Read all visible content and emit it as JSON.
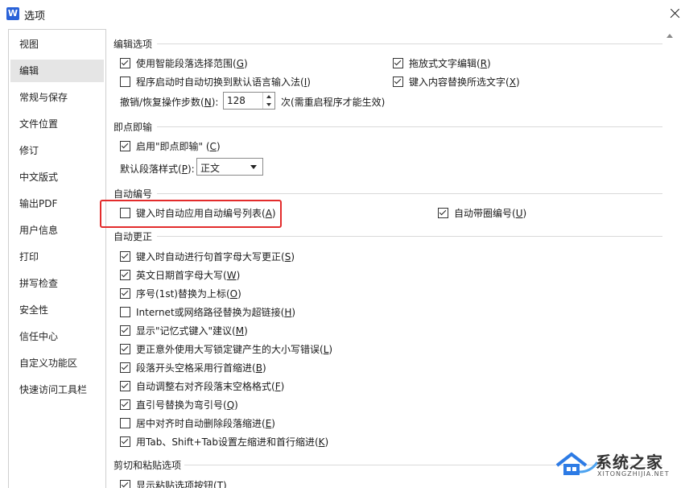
{
  "window": {
    "title": "选项",
    "app_icon_letter": "W"
  },
  "sidebar": {
    "items": [
      {
        "label": "视图",
        "selected": false
      },
      {
        "label": "编辑",
        "selected": true
      },
      {
        "label": "常规与保存",
        "selected": false
      },
      {
        "label": "文件位置",
        "selected": false
      },
      {
        "label": "修订",
        "selected": false
      },
      {
        "label": "中文版式",
        "selected": false
      },
      {
        "label": "输出PDF",
        "selected": false
      },
      {
        "label": "用户信息",
        "selected": false
      },
      {
        "label": "打印",
        "selected": false
      },
      {
        "label": "拼写检查",
        "selected": false
      },
      {
        "label": "安全性",
        "selected": false
      },
      {
        "label": "信任中心",
        "selected": false
      },
      {
        "label": "自定义功能区",
        "selected": false
      },
      {
        "label": "快速访问工具栏",
        "selected": false
      }
    ]
  },
  "edit_options": {
    "heading": "编辑选项",
    "smart_select": {
      "label": "使用智能段落选择范围",
      "key": "G",
      "checked": true
    },
    "auto_ime": {
      "label": "程序启动时自动切换到默认语言输入法",
      "key": "I",
      "checked": false
    },
    "drag_drop": {
      "label": "拖放式文字编辑",
      "key": "R",
      "checked": true
    },
    "typing_replaces": {
      "label": "键入内容替换所选文字",
      "key": "X",
      "checked": true
    },
    "undo_steps": {
      "label": "撤销/恢复操作步数",
      "key": "N",
      "value": "128",
      "note": "次(需重启程序才能生效)"
    }
  },
  "click_and_type": {
    "heading": "即点即输",
    "enable": {
      "label": "启用\"即点即输\"",
      "key": "C",
      "checked": true
    },
    "default_style": {
      "label": "默认段落样式",
      "key": "P",
      "value": "正文"
    }
  },
  "auto_numbering": {
    "heading": "自动编号",
    "auto_list": {
      "label": "键入时自动应用自动编号列表",
      "key": "A",
      "checked": false
    },
    "circled": {
      "label": "自动带圈编号",
      "key": "U",
      "checked": true
    },
    "highlight_color": "#e32c2c"
  },
  "auto_correct": {
    "heading": "自动更正",
    "items": [
      {
        "label": "键入时自动进行句首字母大写更正",
        "key": "S",
        "checked": true
      },
      {
        "label": "英文日期首字母大写",
        "key": "W",
        "checked": true
      },
      {
        "label": "序号(1st)替换为上标",
        "key": "O",
        "checked": true
      },
      {
        "label": "Internet或网络路径替换为超链接",
        "key": "H",
        "checked": false
      },
      {
        "label": "显示\"记忆式键入\"建议",
        "key": "M",
        "checked": true
      },
      {
        "label": "更正意外使用大写锁定键产生的大小写错误",
        "key": "L",
        "checked": true
      },
      {
        "label": "段落开头空格采用行首缩进",
        "key": "B",
        "checked": true
      },
      {
        "label": "自动调整右对齐段落末空格格式",
        "key": "F",
        "checked": true
      },
      {
        "label": "直引号替换为弯引号",
        "key": "Q",
        "checked": true
      },
      {
        "label": "居中对齐时自动删除段落缩进",
        "key": "E",
        "checked": false
      },
      {
        "label": "用Tab、Shift+Tab设置左缩进和首行缩进",
        "key": "K",
        "checked": true
      }
    ]
  },
  "paste_options": {
    "heading": "剪切和粘贴选项",
    "show_button": {
      "label": "显示粘贴选项按钮",
      "key": "T",
      "checked": true
    }
  },
  "watermark": {
    "text": "系统之家",
    "url": "XITONGZHIJIA.NET"
  }
}
